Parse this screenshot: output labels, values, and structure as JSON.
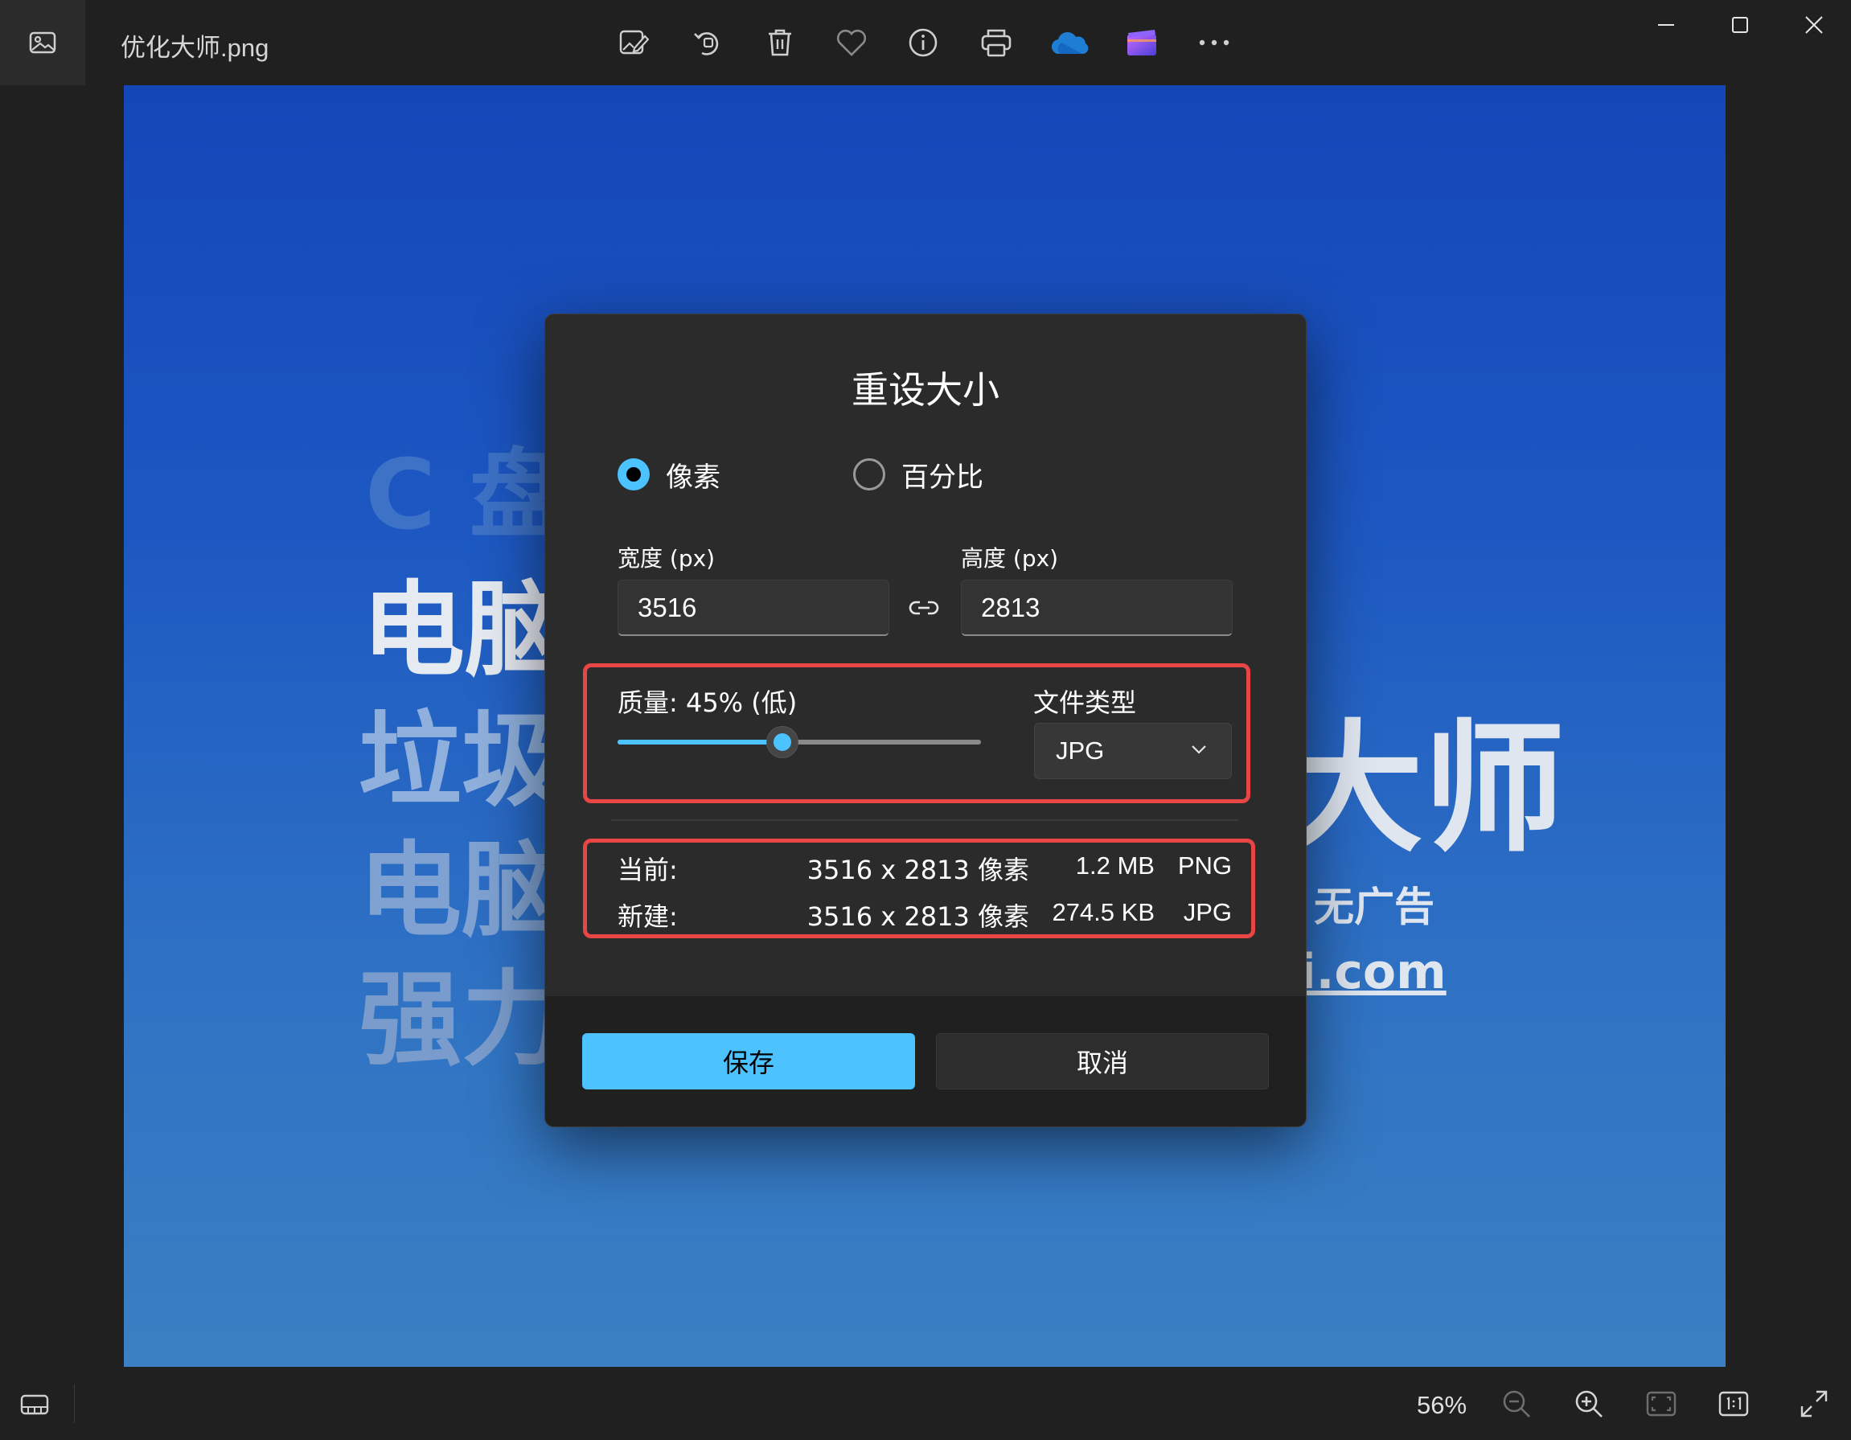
{
  "window": {
    "file_name": "优化大师.png"
  },
  "toolbar": {
    "icons": [
      "edit-image-icon",
      "rotate-icon",
      "delete-icon",
      "favorite-icon",
      "info-icon",
      "print-icon",
      "onedrive-icon",
      "video-editor-icon",
      "more-icon"
    ]
  },
  "background": {
    "line1": "C 盘",
    "line2": "电脑",
    "line3": "垃圾",
    "line4": "电脑",
    "line5": "强力",
    "right_big": "大师",
    "right_small": "无广告",
    "right_link": "i.com"
  },
  "dialog": {
    "title": "重设大小",
    "radio_pixels": "像素",
    "radio_percent": "百分比",
    "width_label": "宽度 (px)",
    "width_value": "3516",
    "height_label": "高度 (px)",
    "height_value": "2813",
    "quality_label": "质量: 45% (低)",
    "quality_value": 0.45,
    "filetype_label": "文件类型",
    "filetype_value": "JPG",
    "current_label": "当前:",
    "current_dims": "3516 x 2813 像素",
    "current_size": "1.2 MB",
    "current_type": "PNG",
    "new_label": "新建:",
    "new_dims": "3516 x 2813 像素",
    "new_size": "274.5 KB",
    "new_type": "JPG",
    "save_label": "保存",
    "cancel_label": "取消"
  },
  "status": {
    "zoom": "56%"
  },
  "colors": {
    "accent": "#4cc2ff",
    "highlight": "#e84545",
    "dialog_bg": "#2b2b2b",
    "chrome_bg": "#202020"
  }
}
